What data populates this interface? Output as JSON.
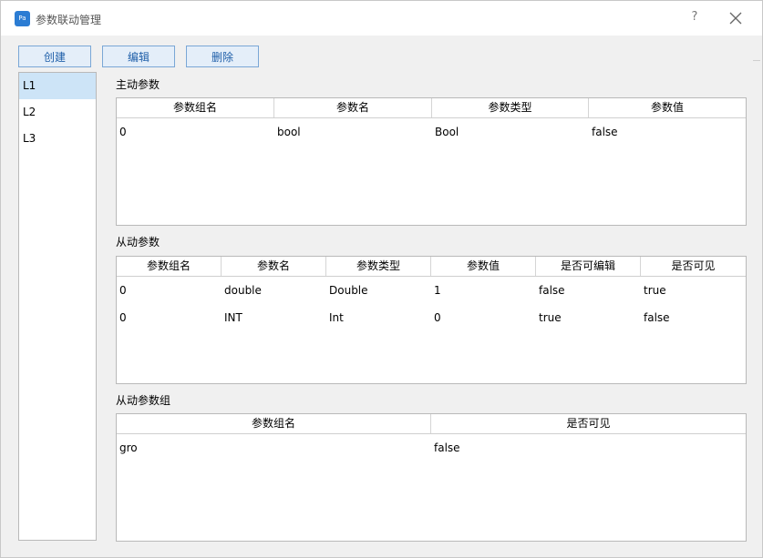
{
  "window": {
    "title": "参数联动管理",
    "icon": "app-icon",
    "help_label": "?",
    "close_icon": "close-icon"
  },
  "toolbar": {
    "create_label": "创建",
    "edit_label": "编辑",
    "delete_label": "删除"
  },
  "sidebar": {
    "items": [
      {
        "label": "L1",
        "selected": true
      },
      {
        "label": "L2",
        "selected": false
      },
      {
        "label": "L3",
        "selected": false
      }
    ]
  },
  "master": {
    "label": "主动参数",
    "columns": [
      "参数组名",
      "参数名",
      "参数类型",
      "参数值"
    ],
    "rows": [
      [
        "0",
        "bool",
        "Bool",
        "false"
      ]
    ]
  },
  "slave": {
    "label": "从动参数",
    "columns": [
      "参数组名",
      "参数名",
      "参数类型",
      "参数值",
      "是否可编辑",
      "是否可见"
    ],
    "rows": [
      [
        "0",
        "double",
        "Double",
        "1",
        "false",
        "true"
      ],
      [
        "0",
        "INT",
        "Int",
        "0",
        "true",
        "false"
      ]
    ]
  },
  "slave_group": {
    "label": "从动参数组",
    "columns": [
      "参数组名",
      "是否可见"
    ],
    "rows": [
      [
        "gro",
        "false"
      ]
    ]
  },
  "colors": {
    "button_bg": "#e4eef9",
    "button_border": "#7aa7d6",
    "button_text": "#1f5fa9",
    "selection": "#cde4f7"
  }
}
